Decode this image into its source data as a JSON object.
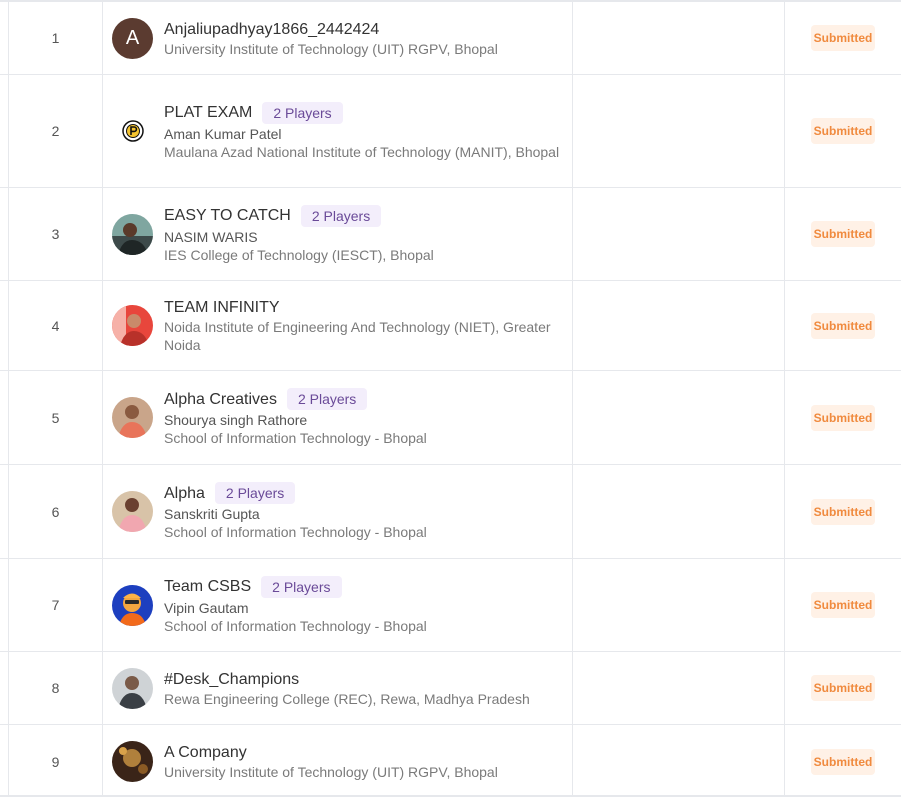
{
  "status_label": "Submitted",
  "rows": [
    {
      "rank": "1",
      "avatar_letter": "A",
      "name": "Anjaliupadhyay1866_2442424",
      "players": "",
      "leader": "",
      "college": "University Institute of Technology (UIT) RGPV, Bhopal"
    },
    {
      "rank": "2",
      "avatar_letter": "",
      "name": "PLAT EXAM",
      "players": "2 Players",
      "leader": "Aman Kumar Patel",
      "college": "Maulana Azad National Institute of Technology (MANIT), Bhopal"
    },
    {
      "rank": "3",
      "avatar_letter": "",
      "name": "EASY TO CATCH",
      "players": "2 Players",
      "leader": "NASIM WARIS",
      "college": "IES College of Technology (IESCT), Bhopal"
    },
    {
      "rank": "4",
      "avatar_letter": "",
      "name": "TEAM INFINITY",
      "players": "",
      "leader": "",
      "college": "Noida Institute of Engineering And Technology (NIET), Greater Noida"
    },
    {
      "rank": "5",
      "avatar_letter": "",
      "name": "Alpha Creatives",
      "players": "2 Players",
      "leader": "Shourya singh Rathore",
      "college": "School of Information Technology - Bhopal"
    },
    {
      "rank": "6",
      "avatar_letter": "",
      "name": "Alpha",
      "players": "2 Players",
      "leader": "Sanskriti Gupta",
      "college": "School of Information Technology - Bhopal"
    },
    {
      "rank": "7",
      "avatar_letter": "",
      "name": "Team CSBS",
      "players": "2 Players",
      "leader": "Vipin Gautam",
      "college": "School of Information Technology - Bhopal"
    },
    {
      "rank": "8",
      "avatar_letter": "",
      "name": "#Desk_Champions",
      "players": "",
      "leader": "",
      "college": "Rewa Engineering College (REC), Rewa, Madhya Pradesh"
    },
    {
      "rank": "9",
      "avatar_letter": "",
      "name": "A Company",
      "players": "",
      "leader": "",
      "college": "University Institute of Technology (UIT) RGPV, Bhopal"
    }
  ],
  "colors": {
    "status_text": "#f08a3e",
    "status_bg": "#fff1e6",
    "players_text": "#6a4a98",
    "players_bg": "#f3eefb",
    "letter_avatar_bg": "#5b3b30"
  }
}
